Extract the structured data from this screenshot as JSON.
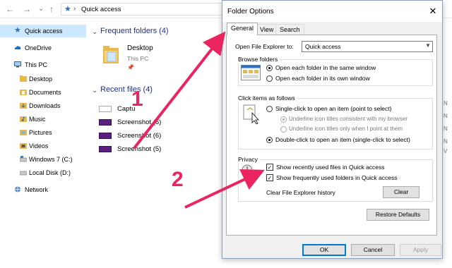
{
  "explorer": {
    "nav": {
      "back": "←",
      "forward": "→",
      "down": "⌄",
      "up": "↑"
    },
    "address": "Quick access",
    "sidebar": [
      {
        "label": "Quick access",
        "icon": "star-icon",
        "active": true
      },
      {
        "label": "OneDrive",
        "icon": "cloud-icon"
      },
      {
        "label": "This PC",
        "icon": "computer-icon"
      },
      {
        "label": "Desktop",
        "icon": "folder-icon"
      },
      {
        "label": "Documents",
        "icon": "folder-icon"
      },
      {
        "label": "Downloads",
        "icon": "folder-icon"
      },
      {
        "label": "Music",
        "icon": "music-icon"
      },
      {
        "label": "Pictures",
        "icon": "folder-icon"
      },
      {
        "label": "Videos",
        "icon": "folder-icon"
      },
      {
        "label": "Windows 7 (C:)",
        "icon": "drive-icon"
      },
      {
        "label": "Local Disk (D:)",
        "icon": "drive-icon"
      },
      {
        "label": "Network",
        "icon": "network-icon"
      }
    ],
    "frequent_title": "Frequent folders (4)",
    "frequent_folder": {
      "name": "Desktop",
      "location": "This PC"
    },
    "recent_title": "Recent files (4)",
    "recent_files": [
      "Captu",
      "Screenshot (6)",
      "Screenshot (6)",
      "Screenshot (5)"
    ],
    "right_letters": [
      "N",
      "N",
      "N",
      "N",
      "V"
    ]
  },
  "dialog": {
    "title": "Folder Options",
    "close": "✕",
    "tabs": [
      "General",
      "View",
      "Search"
    ],
    "open_label": "Open File Explorer to:",
    "open_value": "Quick access",
    "browse": {
      "title": "Browse folders",
      "options": [
        "Open each folder in the same window",
        "Open each folder in its own window"
      ]
    },
    "click": {
      "title": "Click items as follows",
      "single": "Single-click to open an item (point to select)",
      "underline_consistent": "Underline icon titles consistent with my browser",
      "underline_point": "Underline icon titles only when I point at them",
      "double": "Double-click to open an item (single-click to select)"
    },
    "privacy": {
      "title": "Privacy",
      "show_recent": "Show recently used files in Quick access",
      "show_frequent": "Show frequently used folders in Quick access",
      "clear_label": "Clear File Explorer history",
      "clear_btn": "Clear"
    },
    "restore_btn": "Restore Defaults",
    "ok": "OK",
    "cancel": "Cancel",
    "apply": "Apply"
  },
  "annotations": {
    "one": "1",
    "two": "2",
    "color": "#e9245f"
  }
}
